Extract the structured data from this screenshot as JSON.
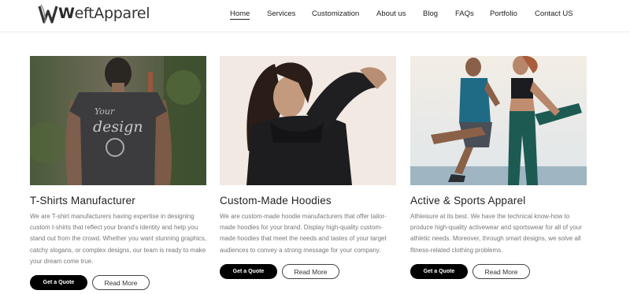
{
  "brand": {
    "name_bold": "W",
    "name_rest": "eftApparel"
  },
  "nav": {
    "items": [
      {
        "label": "Home",
        "active": true
      },
      {
        "label": "Services",
        "active": false
      },
      {
        "label": "Customization",
        "active": false
      },
      {
        "label": "About us",
        "active": false
      },
      {
        "label": "Blog",
        "active": false
      },
      {
        "label": "FAQs",
        "active": false
      },
      {
        "label": "Portfolio",
        "active": false
      },
      {
        "label": "Contact US",
        "active": false
      }
    ]
  },
  "cards": [
    {
      "title": "T-Shirts Manufacturer",
      "description": "We are T-shirt manufacturers having expertise in designing custom t-shirts that reflect your brand's identity and help you stand out from the crowd. Whether you want stunning graphics, catchy slogans, or complex designs, our team is ready to make your dream come true.",
      "quote_label": "Get a Quote",
      "read_label": "Read More",
      "image": "man-in-printed-tshirt-photo"
    },
    {
      "title": "Custom-Made Hoodies",
      "description": "We are custom-made hoodie manufacturers that offer tailor-made hoodies for your brand. Display high-quality custom-made hoodies that meet the needs and tastes of your target audiences to convey a strong message for your company.",
      "quote_label": "Get a Quote",
      "read_label": "Read More",
      "image": "woman-in-black-hoodie-photo"
    },
    {
      "title": "Active & Sports Apparel",
      "description": "Athleisure at its best. We have the technical know-how to produce high-quality activewear and sportswear for all of your athletic needs. Moreover, through smart designs, we solve all fitness-related clothing problems.",
      "quote_label": "Get a Quote",
      "read_label": "Read More",
      "image": "couple-stretching-activewear-photo"
    }
  ]
}
